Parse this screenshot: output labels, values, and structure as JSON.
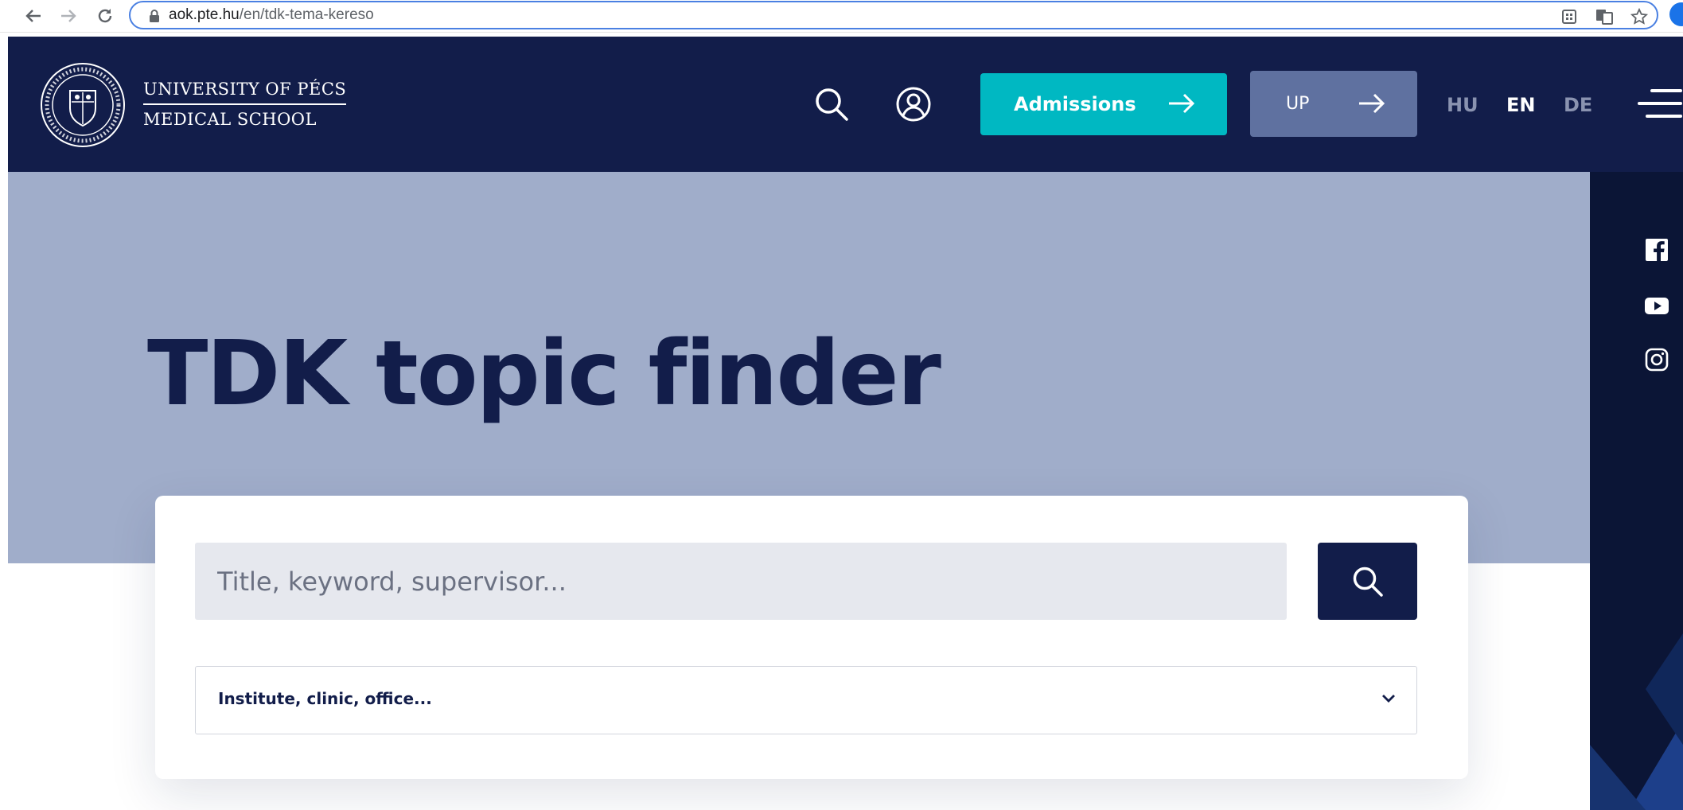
{
  "browser": {
    "url_domain": "aok.pte.hu",
    "url_path": "/en/tdk-tema-kereso"
  },
  "header": {
    "logo_line1": "UNIVERSITY OF PÉCS",
    "logo_line2": "MEDICAL SCHOOL",
    "admissions_label": "Admissions",
    "up_label": "UP",
    "languages": [
      {
        "code": "HU",
        "active": false
      },
      {
        "code": "EN",
        "active": true
      },
      {
        "code": "DE",
        "active": false
      }
    ]
  },
  "hero": {
    "title": "TDK topic finder"
  },
  "search": {
    "placeholder": "Title, keyword, supervisor...",
    "filter_value": "Institute, clinic, office..."
  },
  "social": [
    "facebook-icon",
    "youtube-icon",
    "instagram-icon"
  ],
  "colors": {
    "navy": "#121d4a",
    "teal": "#00b8c2",
    "hero_bg": "#a0adca",
    "up_button": "#5f71a0"
  }
}
